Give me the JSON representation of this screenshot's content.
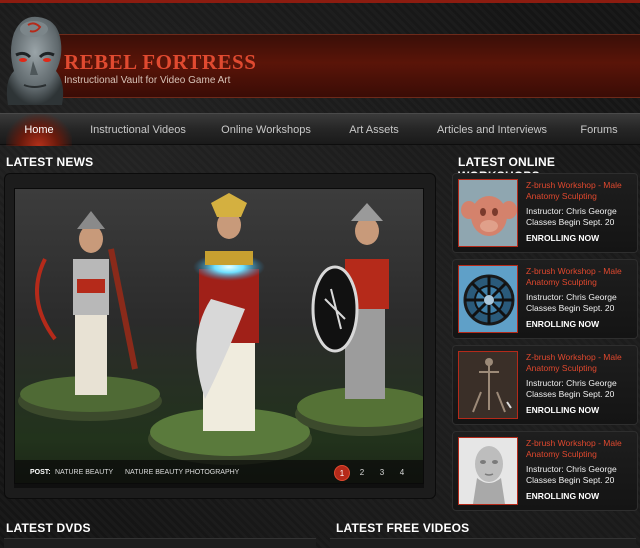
{
  "site": {
    "title": "REBEL FORTRESS",
    "tagline": "Instructional Vault for Video Game Art"
  },
  "nav": {
    "items": [
      {
        "label": "Home",
        "active": true
      },
      {
        "label": "Instructional Videos"
      },
      {
        "label": "Online Workshops"
      },
      {
        "label": "Art Assets"
      },
      {
        "label": "Articles and Interviews"
      },
      {
        "label": "Forums"
      }
    ]
  },
  "sections": {
    "latest_news": "LATEST NEWS",
    "latest_workshops": "LATEST ONLINE WORKSHOPS",
    "latest_dvds": "LATEST DVDS",
    "latest_free_videos": "LATEST FREE VIDEOS"
  },
  "slider": {
    "post_label": "POST:",
    "post_category": "NATURE BEAUTY",
    "post_title": "NATURE BEAUTY PHOTOGRAPHY",
    "pages": [
      "1",
      "2",
      "3",
      "4"
    ],
    "active_page": "1"
  },
  "workshops": [
    {
      "title": "Z-brush Workshop - Male Anatomy Sculpting",
      "instructor": "Instructor: Chris George",
      "classes": "Classes Begin Sept. 20",
      "cta": "ENROLLING NOW",
      "thumb": "monkey-head"
    },
    {
      "title": "Z-brush Workshop - Male Anatomy Sculpting",
      "instructor": "Instructor: Chris George",
      "classes": "Classes Begin Sept. 20",
      "cta": "ENROLLING NOW",
      "thumb": "wheel"
    },
    {
      "title": "Z-brush Workshop - Male Anatomy Sculpting",
      "instructor": "Instructor: Chris George",
      "classes": "Classes Begin Sept. 20",
      "cta": "ENROLLING NOW",
      "thumb": "skeleton"
    },
    {
      "title": "Z-brush Workshop - Male Anatomy Sculpting",
      "instructor": "Instructor: Chris George",
      "classes": "Classes Begin Sept. 20",
      "cta": "ENROLLING NOW",
      "thumb": "bust"
    }
  ],
  "colors": {
    "accent": "#e0482e",
    "banner": "#5a1408",
    "background": "#161616"
  }
}
